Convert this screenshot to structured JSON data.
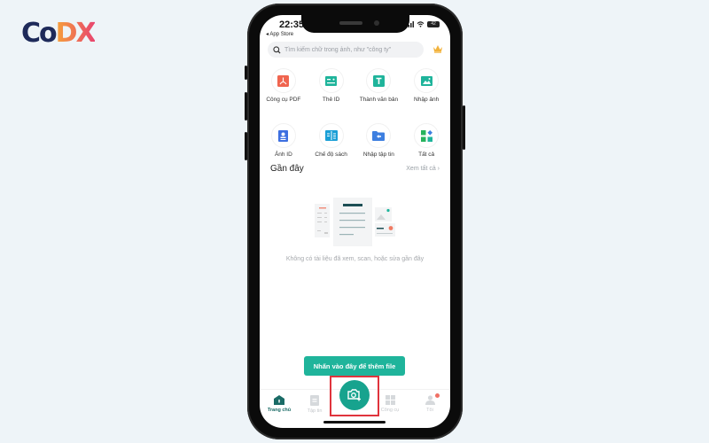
{
  "brand": {
    "logo_part1": "Co",
    "logo_part2": "DX"
  },
  "status_bar": {
    "time": "22:35",
    "back_app": "◂ App Store",
    "battery": "42"
  },
  "search": {
    "placeholder": "Tìm kiếm chữ trong ảnh, như \"công ty\""
  },
  "tools": [
    {
      "label": "Công cụ PDF",
      "icon": "pdf-icon",
      "color": "#f0654f"
    },
    {
      "label": "Thẻ ID",
      "icon": "id-card-icon",
      "color": "#1fb49b"
    },
    {
      "label": "Thành văn bản",
      "icon": "text-icon",
      "color": "#1fb49b"
    },
    {
      "label": "Nhập ảnh",
      "icon": "image-icon",
      "color": "#1fb49b"
    },
    {
      "label": "Ảnh ID",
      "icon": "id-photo-icon",
      "color": "#3d6fe0"
    },
    {
      "label": "Chế độ sách",
      "icon": "book-icon",
      "color": "#1a9fd6"
    },
    {
      "label": "Nhập tập tin",
      "icon": "folder-import-icon",
      "color": "#3d7fe0"
    },
    {
      "label": "Tất cả",
      "icon": "all-apps-icon",
      "color": "#1fb49b"
    }
  ],
  "recent": {
    "title": "Gần đây",
    "see_all": "Xem tất cả ›",
    "empty_message": "Không có tài liệu đã xem, scan, hoặc sửa gần đây"
  },
  "add_file_button": "Nhấn vào đây để thêm file",
  "tabbar": {
    "items": [
      {
        "label": "Trang chủ",
        "active": true
      },
      {
        "label": "Tập tin",
        "active": false
      },
      {
        "label": "Công cụ",
        "active": false
      },
      {
        "label": "Tôi",
        "active": false,
        "badge": true
      }
    ]
  },
  "colors": {
    "accent": "#1fb49b",
    "highlight": "#e0343d"
  }
}
